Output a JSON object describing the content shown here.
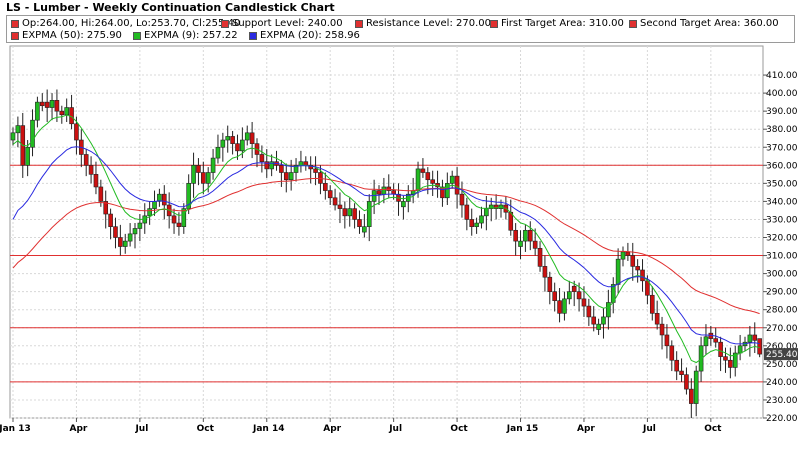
{
  "title": "LS - Lumber - Weekly Continuation Candlestick Chart",
  "legend": [
    {
      "label": "Op:264.00, Hi:264.00, Lo:253.70, Cl:255.40",
      "color": "#e03030"
    },
    {
      "label": "Support Level: 240.00",
      "color": "#e03030"
    },
    {
      "label": "Resistance Level: 270.00",
      "color": "#e03030"
    },
    {
      "label": "First Target Area: 310.00",
      "color": "#e03030"
    },
    {
      "label": "Second Target Area: 360.00",
      "color": "#e03030"
    },
    {
      "label": "EXPMA (50): 275.90",
      "color": "#e03030"
    },
    {
      "label": "EXPMA (9): 257.22",
      "color": "#22bb22"
    },
    {
      "label": "EXPMA (20): 258.96",
      "color": "#2a2ae0"
    }
  ],
  "chart_data": {
    "type": "candlestick",
    "title": "LS - Lumber - Weekly Continuation Candlestick Chart",
    "ylim": [
      220,
      420
    ],
    "y_ticks": [
      220,
      230,
      240,
      250,
      260,
      270,
      280,
      290,
      300,
      310,
      320,
      330,
      340,
      350,
      360,
      370,
      380,
      390,
      400,
      410
    ],
    "x_ticks": [
      {
        "label": "Jan 13",
        "week": 0
      },
      {
        "label": "Apr",
        "week": 13
      },
      {
        "label": "Jul",
        "week": 26
      },
      {
        "label": "Oct",
        "week": 39
      },
      {
        "label": "Jan 14",
        "week": 52
      },
      {
        "label": "Apr",
        "week": 65
      },
      {
        "label": "Jul",
        "week": 78
      },
      {
        "label": "Oct",
        "week": 91
      },
      {
        "label": "Jan 15",
        "week": 104
      },
      {
        "label": "Apr",
        "week": 117
      },
      {
        "label": "Jul",
        "week": 130
      },
      {
        "label": "Oct",
        "week": 143
      }
    ],
    "last_price_label": "255.40",
    "horizontal_levels": [
      {
        "name": "Second Target Area",
        "value": 360,
        "color": "#e03030"
      },
      {
        "name": "First Target Area",
        "value": 310,
        "color": "#e03030"
      },
      {
        "name": "Resistance Level",
        "value": 270,
        "color": "#e03030"
      },
      {
        "name": "Support Level",
        "value": 240,
        "color": "#e03030"
      }
    ],
    "closes": [
      378,
      382,
      360,
      370,
      385,
      395,
      393,
      392,
      396,
      390,
      388,
      392,
      383,
      374,
      366,
      360,
      355,
      348,
      340,
      333,
      326,
      320,
      315,
      318,
      322,
      325,
      328,
      332,
      336,
      340,
      344,
      338,
      332,
      328,
      326,
      336,
      350,
      360,
      356,
      350,
      356,
      364,
      370,
      374,
      376,
      372,
      368,
      374,
      378,
      372,
      366,
      362,
      358,
      362,
      360,
      356,
      352,
      356,
      360,
      362,
      360,
      358,
      356,
      350,
      346,
      342,
      338,
      336,
      332,
      336,
      330,
      326,
      326,
      340,
      346,
      344,
      348,
      346,
      344,
      340,
      340,
      344,
      346,
      358,
      356,
      352,
      350,
      348,
      342,
      350,
      354,
      344,
      338,
      330,
      326,
      328,
      332,
      336,
      338,
      336,
      338,
      334,
      324,
      318,
      318,
      324,
      318,
      314,
      304,
      298,
      290,
      285,
      278,
      286,
      290,
      290,
      286,
      282,
      276,
      272,
      272,
      276,
      284,
      294,
      308,
      312,
      310,
      304,
      302,
      296,
      288,
      278,
      272,
      266,
      260,
      252,
      246,
      244,
      236,
      228,
      246,
      260,
      265,
      264,
      262,
      254,
      252,
      248,
      256,
      260,
      262,
      266,
      263,
      256
    ],
    "last_candle": {
      "open": 264.0,
      "high": 264.0,
      "low": 253.7,
      "close": 255.4
    },
    "series": [
      {
        "name": "EXPMA (50)",
        "color": "#e03030",
        "last": 275.9
      },
      {
        "name": "EXPMA (9)",
        "color": "#22bb22",
        "last": 257.22
      },
      {
        "name": "EXPMA (20)",
        "color": "#2a2ae0",
        "last": 258.96
      }
    ],
    "grid": true,
    "legend_position": "top"
  }
}
